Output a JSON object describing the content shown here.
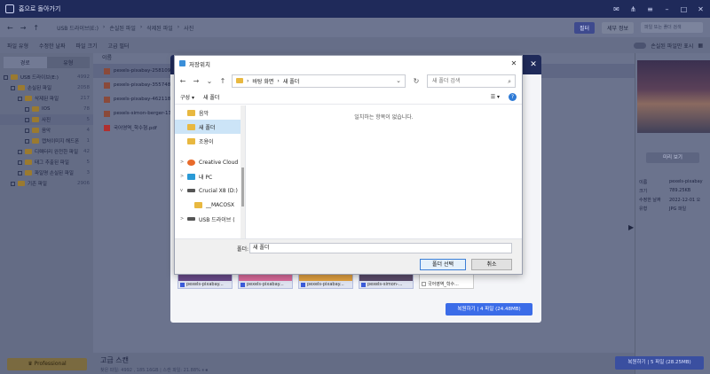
{
  "titlebar": {
    "title": "홈으로 돌아가기"
  },
  "navbar": {
    "path": [
      "USB 드라이브(E:)",
      "손실된 파일",
      "삭제된 파일",
      "사진"
    ],
    "filter_label": "필터",
    "detail_label": "세부 정보",
    "search_placeholder": "파일 또는 폴더 검색"
  },
  "toolbar2": {
    "items": [
      "파일 유형",
      "수정한 날짜",
      "파일 크기",
      "고급 필터"
    ],
    "toggle_label": "손실된 파일만 표시"
  },
  "sidebar": {
    "tabs": [
      "경로",
      "유형"
    ],
    "tree": [
      {
        "label": "USB 드라이브(E:)",
        "count": "4992"
      },
      {
        "label": "손실된 파일",
        "count": "2058"
      },
      {
        "label": "삭제된 파일",
        "count": "217"
      },
      {
        "label": "IOS",
        "count": "78"
      },
      {
        "label": "사진",
        "count": "5"
      },
      {
        "label": "음악",
        "count": "4"
      },
      {
        "label": "캡처이미지 해드폰",
        "count": "1"
      },
      {
        "label": "디렉터리 완전한 파일",
        "count": "42"
      },
      {
        "label": "태그 추출된 파일",
        "count": "5"
      },
      {
        "label": "파일명 손실된 파일",
        "count": "3"
      },
      {
        "label": "기존 파일",
        "count": "2906"
      }
    ],
    "pro_label": "Professional"
  },
  "filelist": {
    "header": "이름",
    "rows": [
      "pexels-pixabay-258109.j",
      "pexels-pixabay-355748.j",
      "pexels-pixabay-462118.j",
      "pexels-simon-berger-13",
      "국어영역_학수형.pdf"
    ]
  },
  "preview": {
    "button_label": "미리 보기",
    "meta": [
      {
        "key": "이름",
        "value": "pexels-pixabay"
      },
      {
        "key": "크기",
        "value": "789.25KB"
      },
      {
        "key": "수정한 날짜",
        "value": "2022-12-01 오"
      },
      {
        "key": "유형",
        "value": "JPG 파일"
      }
    ]
  },
  "status": {
    "title": "고급 스캔",
    "detail": "찾은 파일: 4992 , 185.16GB | 스캔 파일: 21.88%"
  },
  "restore_main_label": "복원하기 | 5 파일 (28.25MB)",
  "restore_dialog": {
    "thumbs": [
      {
        "label": "pexels-pixabay...",
        "color": "#6a4a8a"
      },
      {
        "label": "pexels-pixabay...",
        "color": "#d86a9a"
      },
      {
        "label": "pexels-pixabay...",
        "color": "#e0a040"
      },
      {
        "label": "pexels-simon-...",
        "color": "#5a4a6a"
      },
      {
        "label": "국어영역_학수...",
        "color": "#ffffff"
      }
    ],
    "restore_label": "복원하기 | 4 파일 (24.48MB)"
  },
  "save_dialog": {
    "title": "저장위치",
    "address": [
      "바탕 화면",
      "새 폴더"
    ],
    "search_placeholder": "새 폴더 검색",
    "organize_label": "구성",
    "new_folder_label": "새 폴더",
    "empty_message": "일치하는 항목이 없습니다.",
    "nav_items": [
      {
        "label": "음악",
        "type": "folder",
        "expand": ""
      },
      {
        "label": "새 폴더",
        "type": "folder",
        "expand": "",
        "selected": true
      },
      {
        "label": "조용이",
        "type": "folder",
        "expand": ""
      },
      {
        "label": "Creative Cloud",
        "type": "cloud",
        "expand": ">"
      },
      {
        "label": "내 PC",
        "type": "pc",
        "expand": ">"
      },
      {
        "label": "Crucial X8 (D:)",
        "type": "drive",
        "expand": "v"
      },
      {
        "label": "__MACOSX",
        "type": "folder",
        "expand": ""
      },
      {
        "label": "USB 드라이브 (",
        "type": "drive",
        "expand": ">"
      }
    ],
    "folder_label": "폴더:",
    "folder_value": "새 폴더",
    "ok_label": "폴더 선택",
    "cancel_label": "취소"
  }
}
